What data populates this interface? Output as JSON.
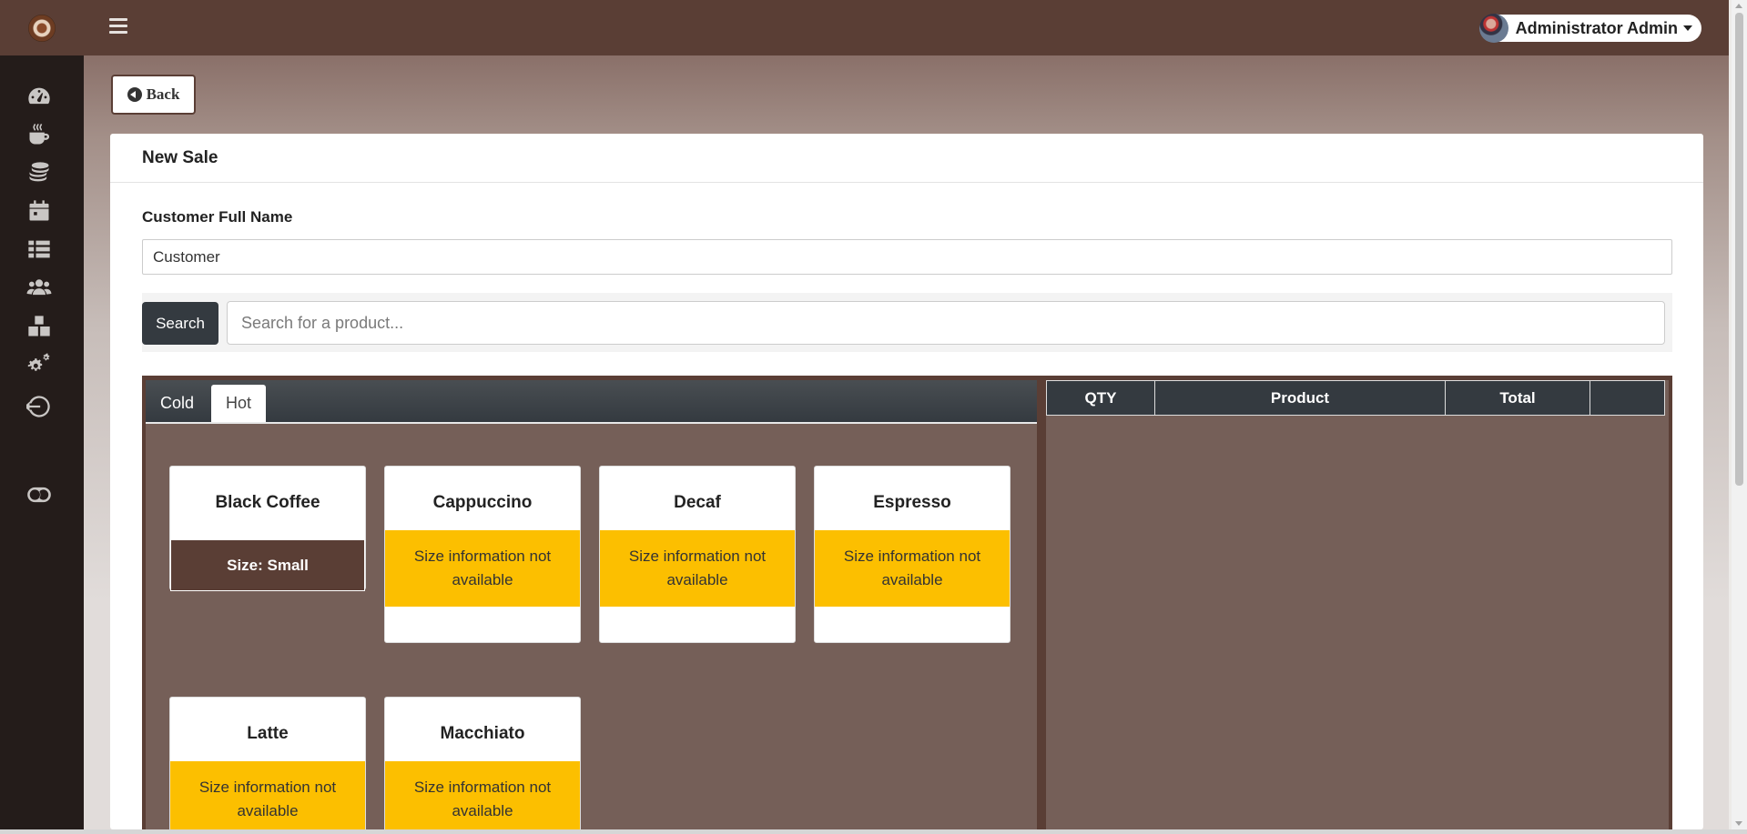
{
  "topbar": {
    "user_name": "Administrator Admin"
  },
  "sidebar": {
    "items": [
      {
        "icon": "dashboard-gauge-icon"
      },
      {
        "icon": "coffee-cup-icon"
      },
      {
        "icon": "coins-icon"
      },
      {
        "icon": "calendar-icon"
      },
      {
        "icon": "list-icon"
      },
      {
        "icon": "users-icon"
      },
      {
        "icon": "boxes-icon"
      },
      {
        "icon": "settings-gears-icon"
      },
      {
        "icon": "logout-icon"
      },
      {
        "icon": "toggle-icon"
      }
    ]
  },
  "page": {
    "back_label": "Back",
    "card_title": "New Sale",
    "customer_label": "Customer Full Name",
    "customer_value": "Customer",
    "search_button": "Search",
    "search_placeholder": "Search for a product..."
  },
  "tabs": [
    {
      "label": "Cold",
      "active": false
    },
    {
      "label": "Hot",
      "active": true
    }
  ],
  "products": [
    {
      "name": "Black Coffee",
      "size": "Size: Small"
    },
    {
      "name": "Cappuccino",
      "size": "Size information not available"
    },
    {
      "name": "Decaf",
      "size": "Size information not available"
    },
    {
      "name": "Espresso",
      "size": "Size information not available"
    },
    {
      "name": "Latte",
      "size": "Size information not available"
    },
    {
      "name": "Macchiato",
      "size": "Size information not available"
    }
  ],
  "cart": {
    "headers": [
      "QTY",
      "Product",
      "Total",
      ""
    ]
  },
  "colors": {
    "brand_dark": "#5a3e35",
    "sidebar_bg": "#241c1a",
    "size_warning": "#fcbf00",
    "dark_button": "#343a40"
  }
}
